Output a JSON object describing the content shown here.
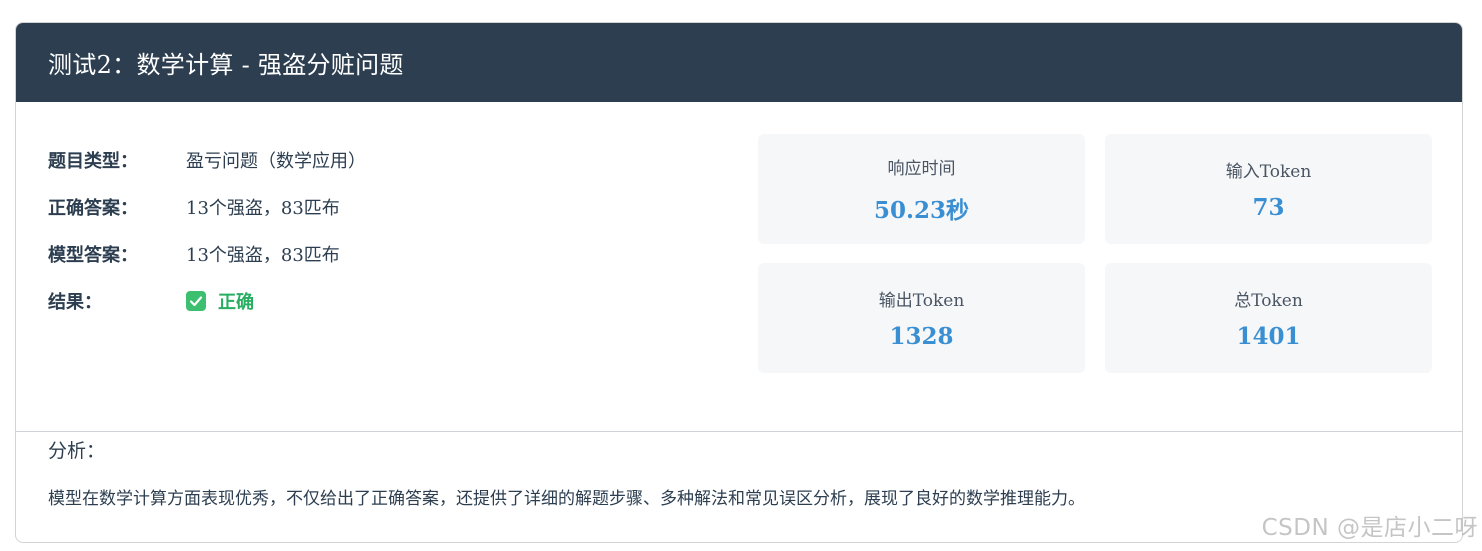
{
  "header": {
    "title": "测试2：数学计算 - 强盗分赃问题"
  },
  "info": {
    "type_label": "题目类型：",
    "type_value": "盈亏问题（数学应用）",
    "answer_label": "正确答案：",
    "answer_value": "13个强盗，83匹布",
    "model_label": "模型答案：",
    "model_value": "13个强盗，83匹布",
    "result_label": "结果：",
    "result_value": "正确",
    "result_icon": "check-icon"
  },
  "stats": [
    {
      "label": "响应时间",
      "value": "50.23秒"
    },
    {
      "label": "输入Token",
      "value": "73"
    },
    {
      "label": "输出Token",
      "value": "1328"
    },
    {
      "label": "总Token",
      "value": "1401"
    }
  ],
  "analysis": {
    "title": "分析：",
    "text": "模型在数学计算方面表现优秀，不仅给出了正确答案，还提供了详细的解题步骤、多种解法和常见误区分析，展现了良好的数学推理能力。"
  },
  "watermark": "CSDN @是店小二呀",
  "colors": {
    "header_bg": "#2c3e50",
    "accent": "#3a8fd3",
    "success": "#27ae60"
  }
}
